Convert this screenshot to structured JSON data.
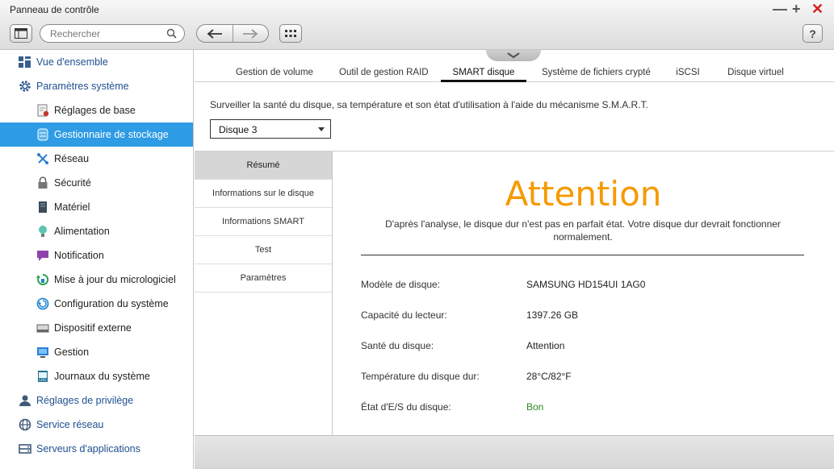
{
  "window": {
    "title": "Panneau de contrôle"
  },
  "toolbar": {
    "search_placeholder": "Rechercher",
    "help_label": "?"
  },
  "sidebar": {
    "items": [
      {
        "label": "Vue d'ensemble",
        "level": "top",
        "icon": "overview-icon"
      },
      {
        "label": "Paramètres système",
        "level": "top",
        "icon": "gear-icon"
      },
      {
        "label": "Réglages de base",
        "level": "sub",
        "icon": "basic-settings-icon"
      },
      {
        "label": "Gestionnaire de stockage",
        "level": "sub",
        "icon": "storage-icon",
        "active": true
      },
      {
        "label": "Réseau",
        "level": "sub",
        "icon": "network-icon"
      },
      {
        "label": "Sécurité",
        "level": "sub",
        "icon": "lock-icon"
      },
      {
        "label": "Matériel",
        "level": "sub",
        "icon": "hardware-icon"
      },
      {
        "label": "Alimentation",
        "level": "sub",
        "icon": "power-icon"
      },
      {
        "label": "Notification",
        "level": "sub",
        "icon": "notification-icon"
      },
      {
        "label": "Mise à jour du micrologiciel",
        "level": "sub",
        "icon": "firmware-update-icon"
      },
      {
        "label": "Configuration du système",
        "level": "sub",
        "icon": "system-config-icon"
      },
      {
        "label": "Dispositif externe",
        "level": "sub",
        "icon": "external-device-icon"
      },
      {
        "label": "Gestion",
        "level": "sub",
        "icon": "monitor-icon"
      },
      {
        "label": "Journaux du système",
        "level": "sub",
        "icon": "system-logs-icon"
      },
      {
        "label": "Réglages de privilège",
        "level": "top",
        "icon": "user-icon"
      },
      {
        "label": "Service réseau",
        "level": "top",
        "icon": "globe-icon"
      },
      {
        "label": "Serveurs d'applications",
        "level": "top",
        "icon": "app-servers-icon"
      }
    ]
  },
  "tabs": [
    {
      "label": "Gestion de volume"
    },
    {
      "label": "Outil de gestion RAID"
    },
    {
      "label": "SMART disque",
      "active": true
    },
    {
      "label": "Système de fichiers crypté"
    },
    {
      "label": "iSCSI"
    },
    {
      "label": "Disque virtuel"
    }
  ],
  "smart": {
    "description": "Surveiller la santé du disque, sa température et son état d'utilisation à l'aide du mécanisme S.M.A.R.T.",
    "disk_select": "Disque 3",
    "subnav": [
      {
        "label": "Résumé",
        "active": true
      },
      {
        "label": "Informations sur le disque"
      },
      {
        "label": "Informations SMART"
      },
      {
        "label": "Test"
      },
      {
        "label": "Paramètres"
      }
    ],
    "status": "Attention",
    "status_color": "#f59a00",
    "analysis": "D'après l'analyse, le disque dur n'est pas en parfait état. Votre disque dur devrait fonctionner normalement.",
    "details": [
      {
        "label": "Modèle de disque:",
        "value": "SAMSUNG HD154UI 1AG0"
      },
      {
        "label": "Capacité du lecteur:",
        "value": "1397.26 GB"
      },
      {
        "label": "Santé du disque:",
        "value": "Attention"
      },
      {
        "label": "Température du disque dur:",
        "value": "28°C/82°F"
      },
      {
        "label": "État d'E/S du disque:",
        "value": "Bon",
        "status": "good"
      }
    ]
  },
  "colors": {
    "accent": "#2e9be5",
    "warning": "#f59a00",
    "good": "#2a8a1e"
  }
}
